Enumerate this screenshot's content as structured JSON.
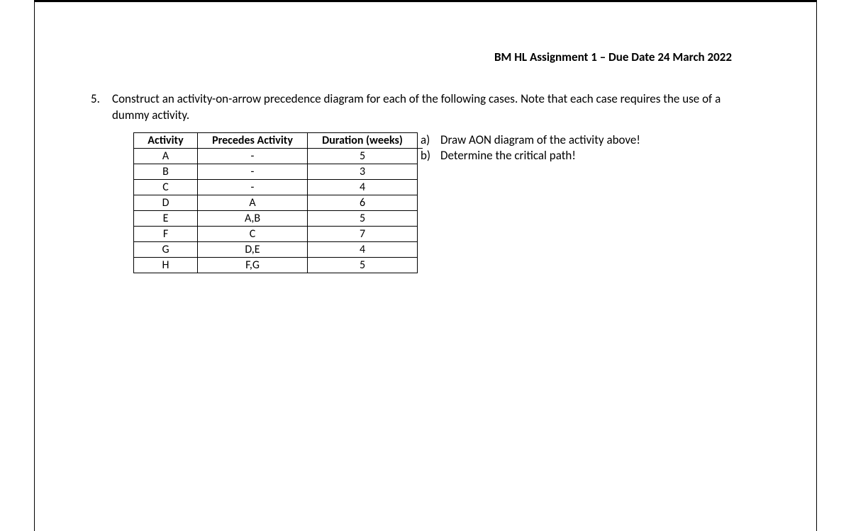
{
  "header": {
    "title": "BM HL Assignment 1 – Due Date 24 March 2022"
  },
  "question": {
    "number": "5.",
    "text": "Construct an activity-on-arrow precedence diagram for each of the following cases. Note that each case requires the use of a dummy activity."
  },
  "table": {
    "headers": {
      "activity": "Activity",
      "precedes": "Precedes Activity",
      "duration": "Duration (weeks)"
    },
    "rows": [
      {
        "activity": "A",
        "precedes": "-",
        "duration": "5"
      },
      {
        "activity": "B",
        "precedes": "-",
        "duration": "3"
      },
      {
        "activity": "C",
        "precedes": "-",
        "duration": "4"
      },
      {
        "activity": "D",
        "precedes": "A",
        "duration": "6"
      },
      {
        "activity": "E",
        "precedes": "A,B",
        "duration": "5"
      },
      {
        "activity": "F",
        "precedes": "C",
        "duration": "7"
      },
      {
        "activity": "G",
        "precedes": "D,E",
        "duration": "4"
      },
      {
        "activity": "H",
        "precedes": "F,G",
        "duration": "5"
      }
    ]
  },
  "subquestions": {
    "a": {
      "letter": "a)",
      "text": "Draw AON diagram of the activity above!"
    },
    "b": {
      "letter": "b)",
      "text": "Determine the critical path!"
    }
  }
}
